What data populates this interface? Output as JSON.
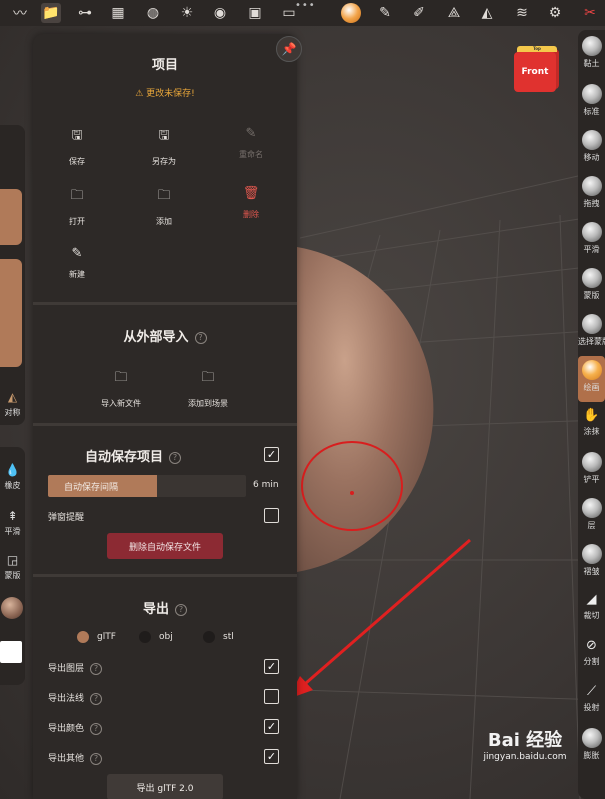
{
  "panel": {
    "title": "项目",
    "warning": "⚠ 更改未保存!",
    "actions": {
      "save": "保存",
      "save_as": "另存为",
      "rename": "重命名",
      "open": "打开",
      "add": "添加",
      "delete": "删除",
      "new": "新建"
    },
    "import": {
      "title": "从外部导入",
      "import_new": "导入新文件",
      "add_to_scene": "添加到场景"
    },
    "autosave": {
      "title": "自动保存项目",
      "enabled": true,
      "interval_label": "自动保存间隔",
      "interval_value": "6 min",
      "interval_fraction": 0.55,
      "popup_label": "弹窗提醒",
      "popup_checked": false,
      "delete_button": "删除自动保存文件"
    },
    "export": {
      "title": "导出",
      "formats": [
        "glTF",
        "obj",
        "stl"
      ],
      "selected_format": "glTF",
      "options": [
        {
          "label": "导出图层",
          "checked": true
        },
        {
          "label": "导出法线",
          "checked": false
        },
        {
          "label": "导出颜色",
          "checked": true
        },
        {
          "label": "导出其他",
          "checked": true
        }
      ],
      "button": "导出 glTF 2.0"
    }
  },
  "left_tools": {
    "symmetry": "对称",
    "eraser": "橡皮",
    "smooth": "平滑",
    "mask": "蒙版"
  },
  "right_tools": [
    "黏土",
    "标准",
    "移动",
    "拖拽",
    "平滑",
    "蒙版",
    "选择蒙版",
    "绘画",
    "涂抹",
    "铲平",
    "层",
    "褶皱",
    "裁切",
    "分割",
    "投射",
    "膨胀"
  ],
  "active_tool": "绘画",
  "view_cube": {
    "face": "Front",
    "top": "Top"
  },
  "watermark": {
    "line1": "Bai 经验",
    "line2": "jingyan.baidu.com"
  },
  "colors": {
    "accent": "#b07a59",
    "danger": "#8c2a33",
    "warning": "#e8a63a",
    "panel": "#2d2927"
  }
}
